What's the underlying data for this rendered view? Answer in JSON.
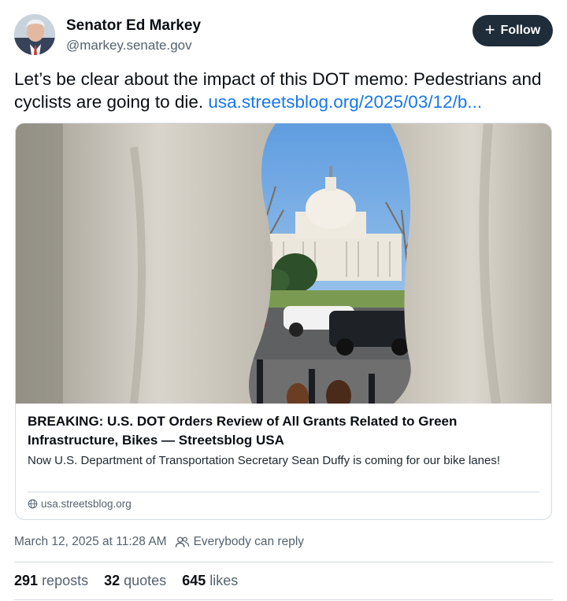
{
  "author": {
    "name": "Senator Ed Markey",
    "handle": "@markey.senate.gov",
    "follow_label": "Follow"
  },
  "post": {
    "text": "Let’s be clear about the impact of this DOT memo: Pedestrians and cyclists are going to die.",
    "link": "usa.streetsblog.org/2025/03/12/b..."
  },
  "card": {
    "title": "BREAKING: U.S. DOT Orders Review of All Grants Related to Green Infrastructure, Bikes — Streetsblog USA",
    "description": "Now U.S. Department of Transportation Secretary Sean Duffy is coming for our bike lanes!",
    "domain": "usa.streetsblog.org"
  },
  "meta": {
    "timestamp": "March 12, 2025 at 11:28 AM",
    "reply_setting": "Everybody can reply"
  },
  "stats": {
    "reposts_count": "291",
    "reposts_label": "reposts",
    "quotes_count": "32",
    "quotes_label": "quotes",
    "likes_count": "645",
    "likes_label": "likes"
  },
  "colors": {
    "link": "#1677ee",
    "follow_button": "#1f2d3b",
    "muted_text": "#55626f"
  },
  "icons": [
    "plus-icon",
    "globe-icon",
    "people-icon"
  ]
}
